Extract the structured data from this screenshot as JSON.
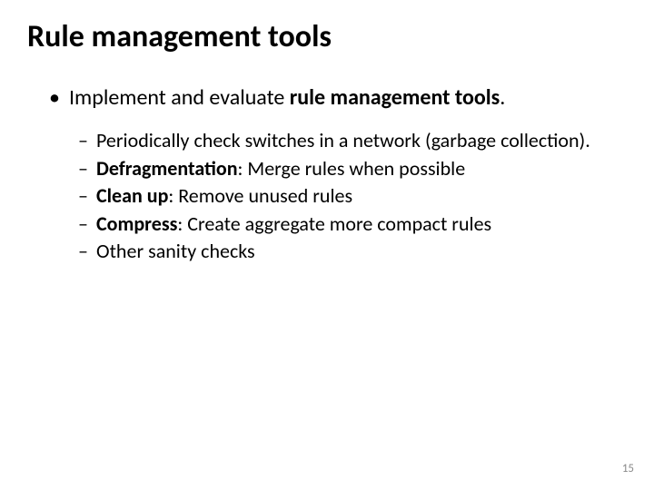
{
  "title": "Rule management tools",
  "bullet1_prefix": "Implement and evaluate ",
  "bullet1_bold": "rule management tools",
  "bullet1_suffix": ".",
  "sub": [
    {
      "bold": "",
      "text": "Periodically check switches in a network (garbage collection)."
    },
    {
      "bold": "Defragmentation",
      "text": ": Merge rules when possible"
    },
    {
      "bold": "Clean up",
      "text": ": Remove unused rules"
    },
    {
      "bold": "Compress",
      "text": ": Create aggregate more compact rules"
    },
    {
      "bold": "",
      "text": "Other sanity checks"
    }
  ],
  "slide_number": "15"
}
